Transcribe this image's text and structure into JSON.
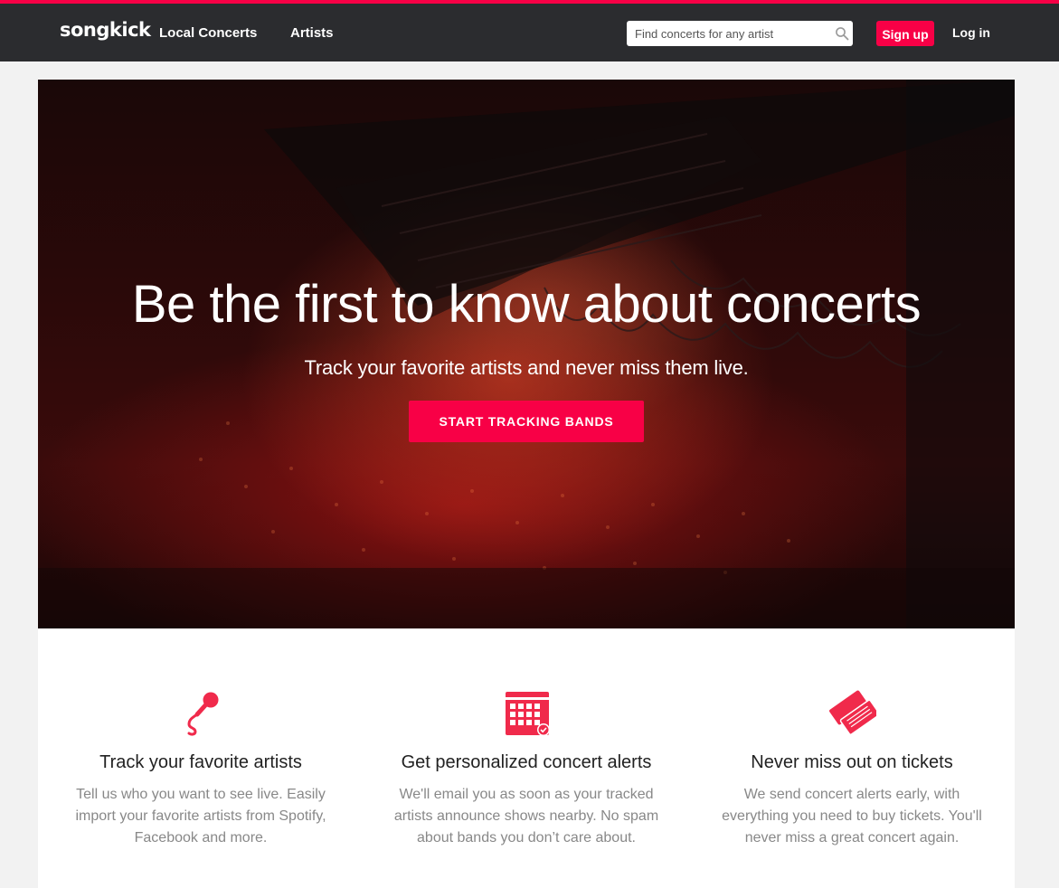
{
  "brand": {
    "name": "songkick",
    "accent": "#f80046",
    "nav_bg": "#2b2c2f"
  },
  "nav": {
    "links": [
      "Local Concerts",
      "Artists"
    ],
    "search_placeholder": "Find concerts for any artist",
    "search_icon": "search-icon",
    "signup_label": "Sign up",
    "login_label": "Log in"
  },
  "hero": {
    "title": "Be the first to know about concerts",
    "subtitle": "Track your favorite artists and never miss them live.",
    "cta_label": "START TRACKING BANDS"
  },
  "features": [
    {
      "icon": "microphone-icon",
      "title": "Track your favorite artists",
      "description": "Tell us who you want to see live. Easily import your favorite artists from Spotify, Facebook and more."
    },
    {
      "icon": "calendar-icon",
      "title": "Get personalized concert alerts",
      "description": "We'll email you as soon as your tracked artists announce shows nearby. No spam about bands you don’t care about."
    },
    {
      "icon": "tickets-icon",
      "title": "Never miss out on tickets",
      "description": "We send concert alerts early, with everything you need to buy tickets. You'll never miss a great concert again."
    }
  ]
}
